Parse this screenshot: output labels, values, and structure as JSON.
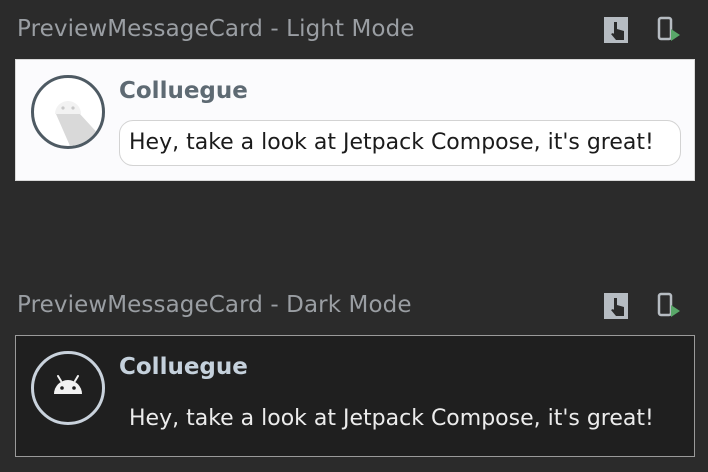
{
  "previews": [
    {
      "title": "PreviewMessageCard - Light Mode",
      "author": "Colluegue",
      "message": "Hey, take a look at Jetpack Compose, it's great!",
      "theme": "light",
      "toolbar_icons": [
        "interactive-mode-icon",
        "deploy-to-device-icon"
      ]
    },
    {
      "title": "PreviewMessageCard - Dark Mode",
      "author": "Colluegue",
      "message": "Hey, take a look at Jetpack Compose, it's great!",
      "theme": "dark",
      "toolbar_icons": [
        "interactive-mode-icon",
        "deploy-to-device-icon"
      ]
    }
  ],
  "colors": {
    "background": "#2b2b2b",
    "light_card": "#fbfbfd",
    "dark_card": "#1f1f1f",
    "run_accent": "#59a869",
    "icon_gray": "#b6bcc2"
  }
}
